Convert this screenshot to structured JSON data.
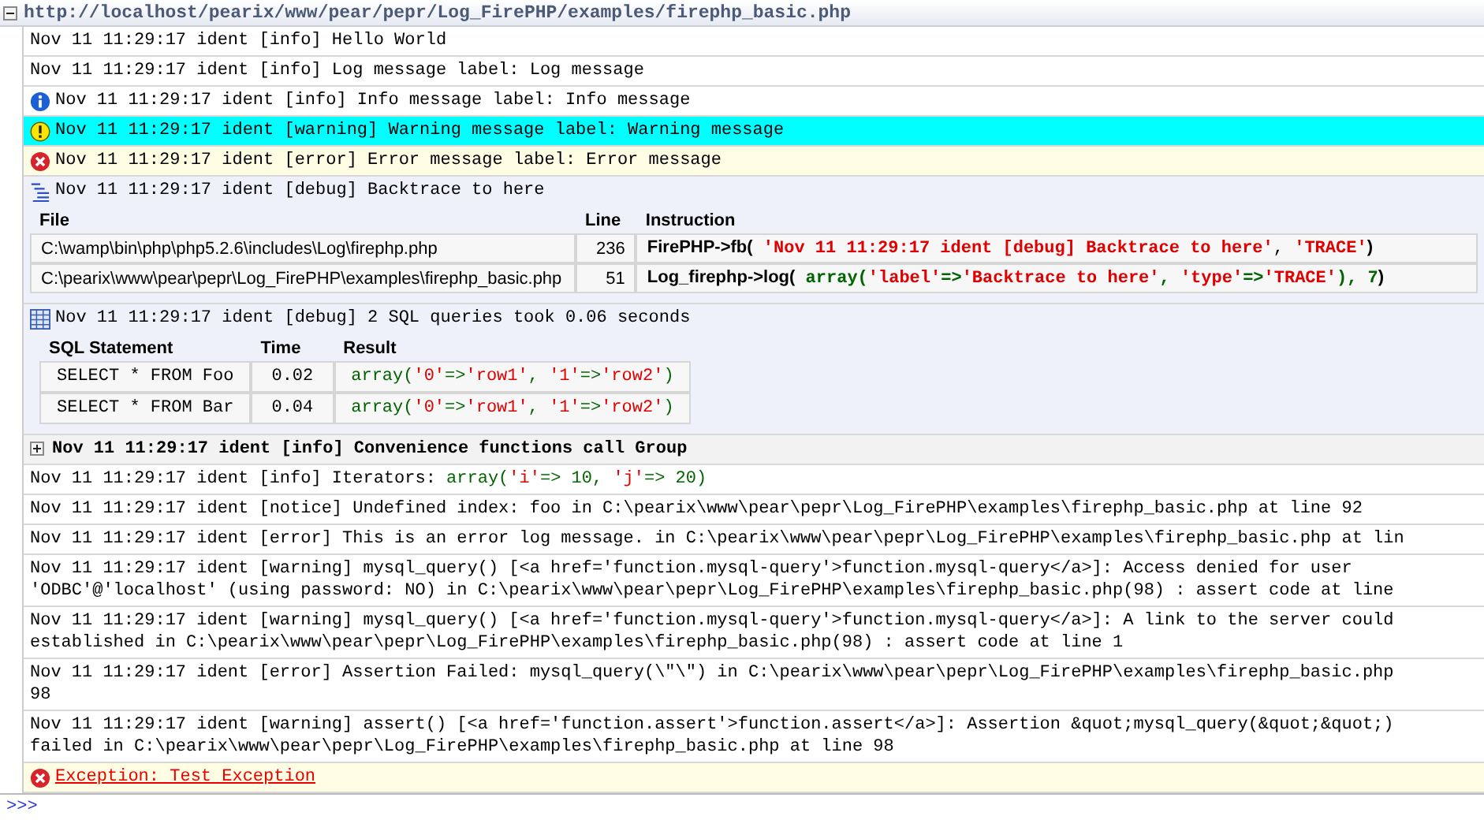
{
  "header": {
    "url": "http://localhost/pearix/www/pear/pepr/Log_FirePHP/examples/firephp_basic.php",
    "expanded": true
  },
  "entries": [
    {
      "kind": "log",
      "selected": false,
      "lines": [
        "Nov 11 11:29:17 ident [info] Hello World"
      ]
    },
    {
      "kind": "log",
      "selected": false,
      "lines": [
        "Nov 11 11:29:17 ident [info] Log message label: Log message"
      ]
    },
    {
      "kind": "info",
      "selected": false,
      "lines": [
        "Nov 11 11:29:17 ident [info] Info message label: Info message"
      ]
    },
    {
      "kind": "warning",
      "selected": true,
      "lines": [
        "Nov 11 11:29:17 ident [warning] Warning message label: Warning message"
      ]
    },
    {
      "kind": "error",
      "selected": false,
      "lines": [
        "Nov 11 11:29:17 ident [error] Error message label: Error message"
      ]
    },
    {
      "kind": "trace",
      "selected": false,
      "lines": [
        "Nov 11 11:29:17 ident [debug] Backtrace to here"
      ],
      "columns": [
        "File",
        "Line",
        "Instruction"
      ],
      "rows": [
        {
          "cells": [
            "C:\\wamp\\bin\\php\\php5.2.6\\includes\\Log\\firephp.php",
            "236"
          ],
          "code": [
            {
              "kind": "call",
              "text": "FirePHP->fb("
            },
            {
              "kind": "str",
              "text": " 'Nov 11 11:29:17 ident [debug] Backtrace to here'"
            },
            {
              "kind": "plain",
              "text": ", "
            },
            {
              "kind": "str",
              "text": "'TRACE'"
            },
            {
              "kind": "call",
              "text": ")"
            }
          ]
        },
        {
          "cells": [
            "C:\\pearix\\www\\pear\\pepr\\Log_FirePHP\\examples\\firephp_basic.php",
            "51"
          ],
          "code": [
            {
              "kind": "call",
              "text": "Log_firephp->log("
            },
            {
              "kind": "code",
              "text": " array("
            },
            {
              "kind": "str",
              "text": "'label'"
            },
            {
              "kind": "code",
              "text": "=>"
            },
            {
              "kind": "str",
              "text": "'Backtrace to here'"
            },
            {
              "kind": "code",
              "text": ", "
            },
            {
              "kind": "str",
              "text": "'type'"
            },
            {
              "kind": "code",
              "text": "=>"
            },
            {
              "kind": "str",
              "text": "'TRACE'"
            },
            {
              "kind": "code",
              "text": "), 7"
            },
            {
              "kind": "call",
              "text": ")"
            }
          ]
        }
      ]
    },
    {
      "kind": "sql",
      "selected": false,
      "lines": [
        "Nov 11 11:29:17 ident [debug] 2 SQL queries took 0.06 seconds"
      ],
      "columns": [
        "SQL Statement",
        "Time",
        "Result"
      ],
      "rows": [
        {
          "cells": [
            "SELECT * FROM Foo",
            "0.02"
          ],
          "code": [
            {
              "kind": "code",
              "text": "array("
            },
            {
              "kind": "str",
              "text": "'0'"
            },
            {
              "kind": "code",
              "text": "=>"
            },
            {
              "kind": "str",
              "text": "'row1'"
            },
            {
              "kind": "code",
              "text": ", "
            },
            {
              "kind": "str",
              "text": "'1'"
            },
            {
              "kind": "code",
              "text": "=>"
            },
            {
              "kind": "str",
              "text": "'row2'"
            },
            {
              "kind": "code",
              "text": ")"
            }
          ]
        },
        {
          "cells": [
            "SELECT * FROM Bar",
            "0.04"
          ],
          "code": [
            {
              "kind": "code",
              "text": "array("
            },
            {
              "kind": "str",
              "text": "'0'"
            },
            {
              "kind": "code",
              "text": "=>"
            },
            {
              "kind": "str",
              "text": "'row1'"
            },
            {
              "kind": "code",
              "text": ", "
            },
            {
              "kind": "str",
              "text": "'1'"
            },
            {
              "kind": "code",
              "text": "=>"
            },
            {
              "kind": "str",
              "text": "'row2'"
            },
            {
              "kind": "code",
              "text": ")"
            }
          ]
        }
      ]
    },
    {
      "kind": "group",
      "selected": false,
      "expanded": false,
      "lines": [
        "Nov 11 11:29:17 ident [info] Convenience functions call Group"
      ]
    },
    {
      "kind": "log",
      "selected": false,
      "lines": [
        "Nov 11 11:29:17 ident [info] Iterators: "
      ],
      "value": [
        {
          "kind": "code",
          "text": "array("
        },
        {
          "kind": "str",
          "text": "'i'"
        },
        {
          "kind": "code",
          "text": "=> 10, "
        },
        {
          "kind": "str",
          "text": "'j'"
        },
        {
          "kind": "code",
          "text": "=> 20)"
        }
      ]
    },
    {
      "kind": "log",
      "selected": false,
      "lines": [
        "Nov 11 11:29:17 ident [notice] Undefined index: foo in C:\\pearix\\www\\pear\\pepr\\Log_FirePHP\\examples\\firephp_basic.php at line 92"
      ]
    },
    {
      "kind": "log",
      "selected": false,
      "lines": [
        "Nov 11 11:29:17 ident [error] This is an error log message. in C:\\pearix\\www\\pear\\pepr\\Log_FirePHP\\examples\\firephp_basic.php at lin"
      ]
    },
    {
      "kind": "log",
      "selected": false,
      "lines": [
        "Nov 11 11:29:17 ident [warning] mysql_query() [<a href='function.mysql-query'>function.mysql-query</a>]: Access denied for user",
        "'ODBC'@'localhost' (using password: NO) in C:\\pearix\\www\\pear\\pepr\\Log_FirePHP\\examples\\firephp_basic.php(98) : assert code at line"
      ]
    },
    {
      "kind": "log",
      "selected": false,
      "lines": [
        "Nov 11 11:29:17 ident [warning] mysql_query() [<a href='function.mysql-query'>function.mysql-query</a>]: A link to the server could",
        "established in C:\\pearix\\www\\pear\\pepr\\Log_FirePHP\\examples\\firephp_basic.php(98) : assert code at line 1"
      ]
    },
    {
      "kind": "log",
      "selected": false,
      "lines": [
        "Nov 11 11:29:17 ident [error] Assertion Failed: mysql_query(\\\"\\\") in C:\\pearix\\www\\pear\\pepr\\Log_FirePHP\\examples\\firephp_basic.php",
        "98"
      ]
    },
    {
      "kind": "log",
      "selected": false,
      "lines": [
        "Nov 11 11:29:17 ident [warning] assert() [<a href='function.assert'>function.assert</a>]: Assertion &quot;mysql_query(&quot;&quot;)",
        "failed in C:\\pearix\\www\\pear\\pepr\\Log_FirePHP\\examples\\firephp_basic.php at line 98"
      ]
    },
    {
      "kind": "exception",
      "selected": false,
      "lines": [
        "Exception: Test Exception"
      ]
    }
  ],
  "command_line": {
    "prompt": ">>>"
  }
}
